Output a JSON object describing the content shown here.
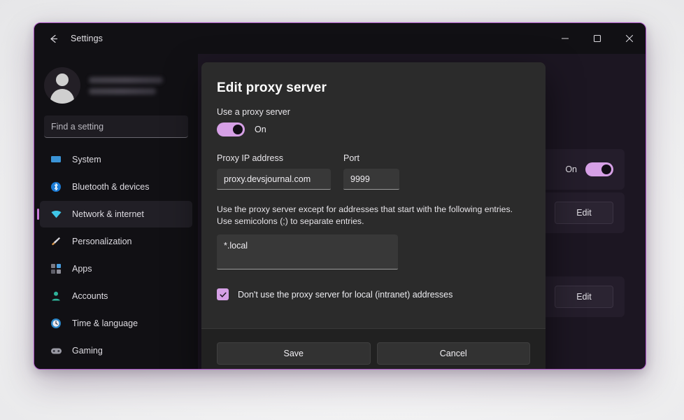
{
  "window": {
    "title": "Settings",
    "back_icon": "back-arrow-icon",
    "minimize_icon": "minimize-icon",
    "maximize_icon": "maximize-icon",
    "close_icon": "close-icon",
    "accent_border": "#a94fc4"
  },
  "sidebar": {
    "avatar_icon": "user-avatar-icon",
    "profile_name_redacted": "",
    "profile_email_redacted": "",
    "search": {
      "placeholder": "Find a setting",
      "value": ""
    },
    "items": [
      {
        "label": "System",
        "icon": "monitor-icon",
        "selected": false
      },
      {
        "label": "Bluetooth & devices",
        "icon": "bluetooth-icon",
        "selected": false
      },
      {
        "label": "Network & internet",
        "icon": "wifi-icon",
        "selected": true
      },
      {
        "label": "Personalization",
        "icon": "paintbrush-icon",
        "selected": false
      },
      {
        "label": "Apps",
        "icon": "apps-grid-icon",
        "selected": false
      },
      {
        "label": "Accounts",
        "icon": "person-icon",
        "selected": false
      },
      {
        "label": "Time & language",
        "icon": "clock-icon",
        "selected": false
      },
      {
        "label": "Gaming",
        "icon": "gamepad-icon",
        "selected": false
      }
    ]
  },
  "content": {
    "rows": [
      {
        "control": "toggle",
        "state_label": "On",
        "toggle_on": true
      },
      {
        "control": "button",
        "button_label": "Edit"
      },
      {
        "control": "button",
        "button_label": "Edit"
      }
    ],
    "accent_color": "#d6a0e6"
  },
  "dialog": {
    "title": "Edit proxy server",
    "use_proxy_label": "Use a proxy server",
    "use_proxy_state": "On",
    "use_proxy_on": true,
    "proxy_ip_label": "Proxy IP address",
    "proxy_ip_value": "proxy.devsjournal.com",
    "proxy_ip_placeholder": "Proxy IP address",
    "port_label": "Port",
    "port_value": "9999",
    "port_placeholder": "Port",
    "exceptions_description": "Use the proxy server except for addresses that start with the following entries. Use semicolons (;) to separate entries.",
    "exceptions_value": "*.local",
    "exceptions_placeholder": "",
    "checkbox_label": "Don't use the proxy server for local (intranet) addresses",
    "checkbox_checked": true,
    "check_icon": "checkmark-icon",
    "save_label": "Save",
    "cancel_label": "Cancel"
  }
}
